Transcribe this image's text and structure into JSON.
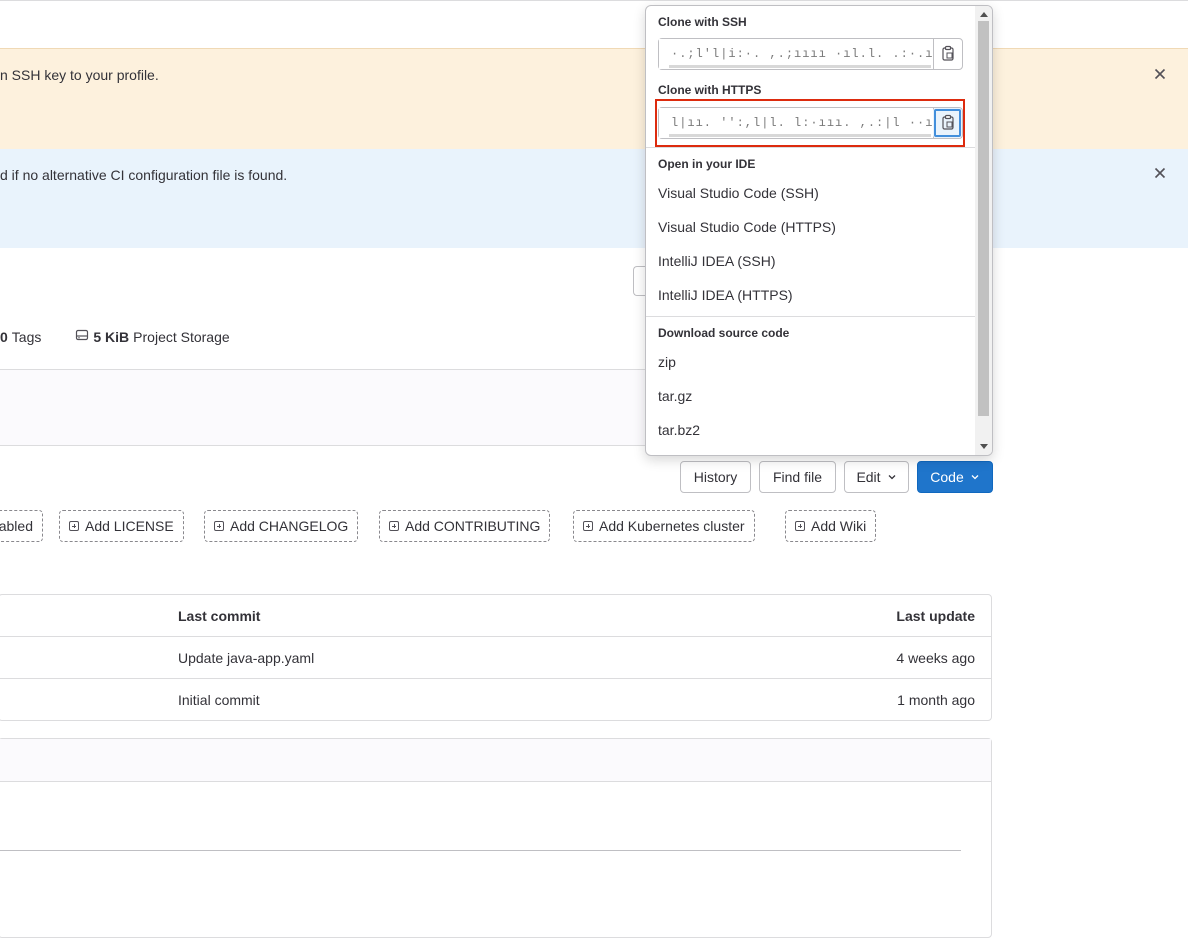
{
  "banners": {
    "ssh_warning": "n SSH key to your profile.",
    "ci_info": "d if no alternative CI configuration file is found."
  },
  "stats": {
    "tags_count": "0",
    "tags_label": "Tags",
    "storage_size": "5 KiB",
    "storage_label": "Project Storage"
  },
  "toolbar": {
    "history": "History",
    "find_file": "Find file",
    "edit": "Edit",
    "code": "Code"
  },
  "quick_actions": {
    "partial": "abled",
    "items": [
      "Add LICENSE",
      "Add CHANGELOG",
      "Add CONTRIBUTING",
      "Add Kubernetes cluster",
      "Add Wiki"
    ]
  },
  "file_table": {
    "headers": {
      "last_commit": "Last commit",
      "last_update": "Last update"
    },
    "rows": [
      {
        "commit": "Update java-app.yaml",
        "updated": "4 weeks ago"
      },
      {
        "commit": "Initial commit",
        "updated": "1 month ago"
      }
    ]
  },
  "code_dropdown": {
    "clone_ssh_label": "Clone with SSH",
    "clone_ssh_value": "·.;l'l|i:·. ,.;ıııı ·ıl.l. .:·.ıııı ·",
    "clone_https_label": "Clone with HTTPS",
    "clone_https_value": "l|ıı. '':,l|l. l:·ııı. ,.:|l ··ıı· l,",
    "ide_label": "Open in your IDE",
    "ide_items": [
      "Visual Studio Code (SSH)",
      "Visual Studio Code (HTTPS)",
      "IntelliJ IDEA (SSH)",
      "IntelliJ IDEA (HTTPS)"
    ],
    "download_label": "Download source code",
    "download_items": [
      "zip",
      "tar.gz",
      "tar.bz2"
    ]
  },
  "colors": {
    "warning_bg": "#fdf1dd",
    "info_bg": "#e9f3fc",
    "primary": "#1f75cb",
    "highlight": "#dd2b0e"
  }
}
